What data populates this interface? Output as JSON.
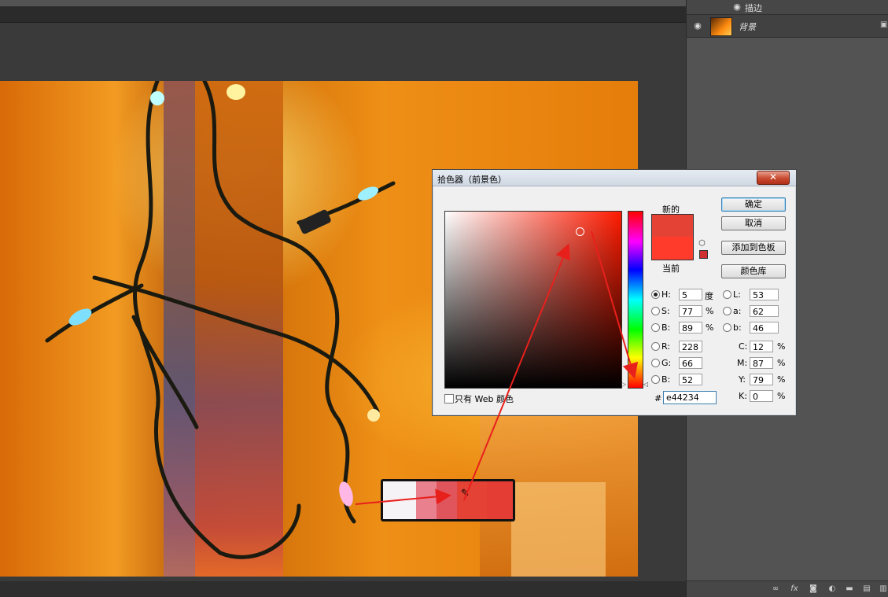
{
  "layers": {
    "fx_label": "描边",
    "layer_name": "背景",
    "footer_icons": [
      "link-icon",
      "fx-icon",
      "mask-icon",
      "adjustment-icon",
      "folder-icon",
      "new-layer-icon",
      "trash-icon"
    ]
  },
  "dialog": {
    "title": "拾色器（前景色）",
    "close": "✕",
    "label_new": "新的",
    "label_current": "当前",
    "buttons": {
      "ok": "确定",
      "cancel": "取消",
      "add_to_swatches": "添加到色板",
      "color_libraries": "颜色库"
    },
    "fields": {
      "H": {
        "label": "H:",
        "value": "5",
        "unit": "度"
      },
      "S": {
        "label": "S:",
        "value": "77",
        "unit": "%"
      },
      "Bv": {
        "label": "B:",
        "value": "89",
        "unit": "%"
      },
      "R": {
        "label": "R:",
        "value": "228"
      },
      "G": {
        "label": "G:",
        "value": "66"
      },
      "Bc": {
        "label": "B:",
        "value": "52"
      },
      "L": {
        "label": "L:",
        "value": "53"
      },
      "a": {
        "label": "a:",
        "value": "62"
      },
      "b": {
        "label": "b:",
        "value": "46"
      },
      "C": {
        "label": "C:",
        "value": "12",
        "unit": "%"
      },
      "M": {
        "label": "M:",
        "value": "87",
        "unit": "%"
      },
      "Y": {
        "label": "Y:",
        "value": "79",
        "unit": "%"
      },
      "K": {
        "label": "K:",
        "value": "0",
        "unit": "%"
      }
    },
    "web_only_label": "只有 Web 颜色",
    "hash": "#",
    "hex_value": "e44234",
    "new_color": "#e44234",
    "current_color": "#ff3b2b"
  },
  "sample_swatches": [
    "#f6f3f7",
    "#e9808e",
    "#e0545c",
    "#e44234",
    "#e43d34"
  ]
}
